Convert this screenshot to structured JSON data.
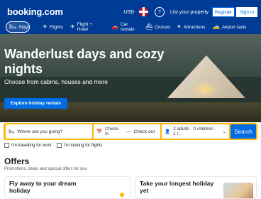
{
  "header": {
    "logo": "booking.com",
    "currency": "USD",
    "help_icon": "?",
    "list_property": "List your property",
    "register": "Register",
    "sign_in": "Sign in"
  },
  "nav": {
    "stays": "Stays",
    "flights": "Flights",
    "flight_hotel": "Flight + Hotel",
    "car_rentals": "Car rentals",
    "cruises": "Cruises",
    "attractions": "Attractions",
    "airport_taxis": "Airport taxis"
  },
  "hero": {
    "title": "Wanderlust days and cozy nights",
    "subtitle": "Choose from cabins, houses and more",
    "cta": "Explore holiday rentals"
  },
  "search": {
    "destination_placeholder": "Where are you going?",
    "check_in": "Check-in",
    "check_out": "Check-out",
    "occupancy": "2 adults · 0 children · 1 r...",
    "button": "Search"
  },
  "checkboxes": {
    "work": "I'm travelling for work",
    "flights": "I'm looking for flights"
  },
  "offers": {
    "title": "Offers",
    "subtitle": "Promotions, deals and special offers for you",
    "card1_title": "Fly away to your dream holiday",
    "card2_title": "Take your longest holiday yet"
  },
  "icons": {
    "stays": "bed-icon",
    "flights": "plane-icon",
    "flight_hotel": "plane-hotel-icon",
    "car": "car-icon",
    "cruises": "ship-icon",
    "attractions": "attraction-icon",
    "taxi": "taxi-icon",
    "destination": "bed-icon",
    "calendar": "calendar-icon",
    "person": "person-icon",
    "chevron": "chevron-down-icon"
  },
  "colors": {
    "brand": "#003b95",
    "accent": "#006ce4",
    "search_border": "#ffb700"
  }
}
